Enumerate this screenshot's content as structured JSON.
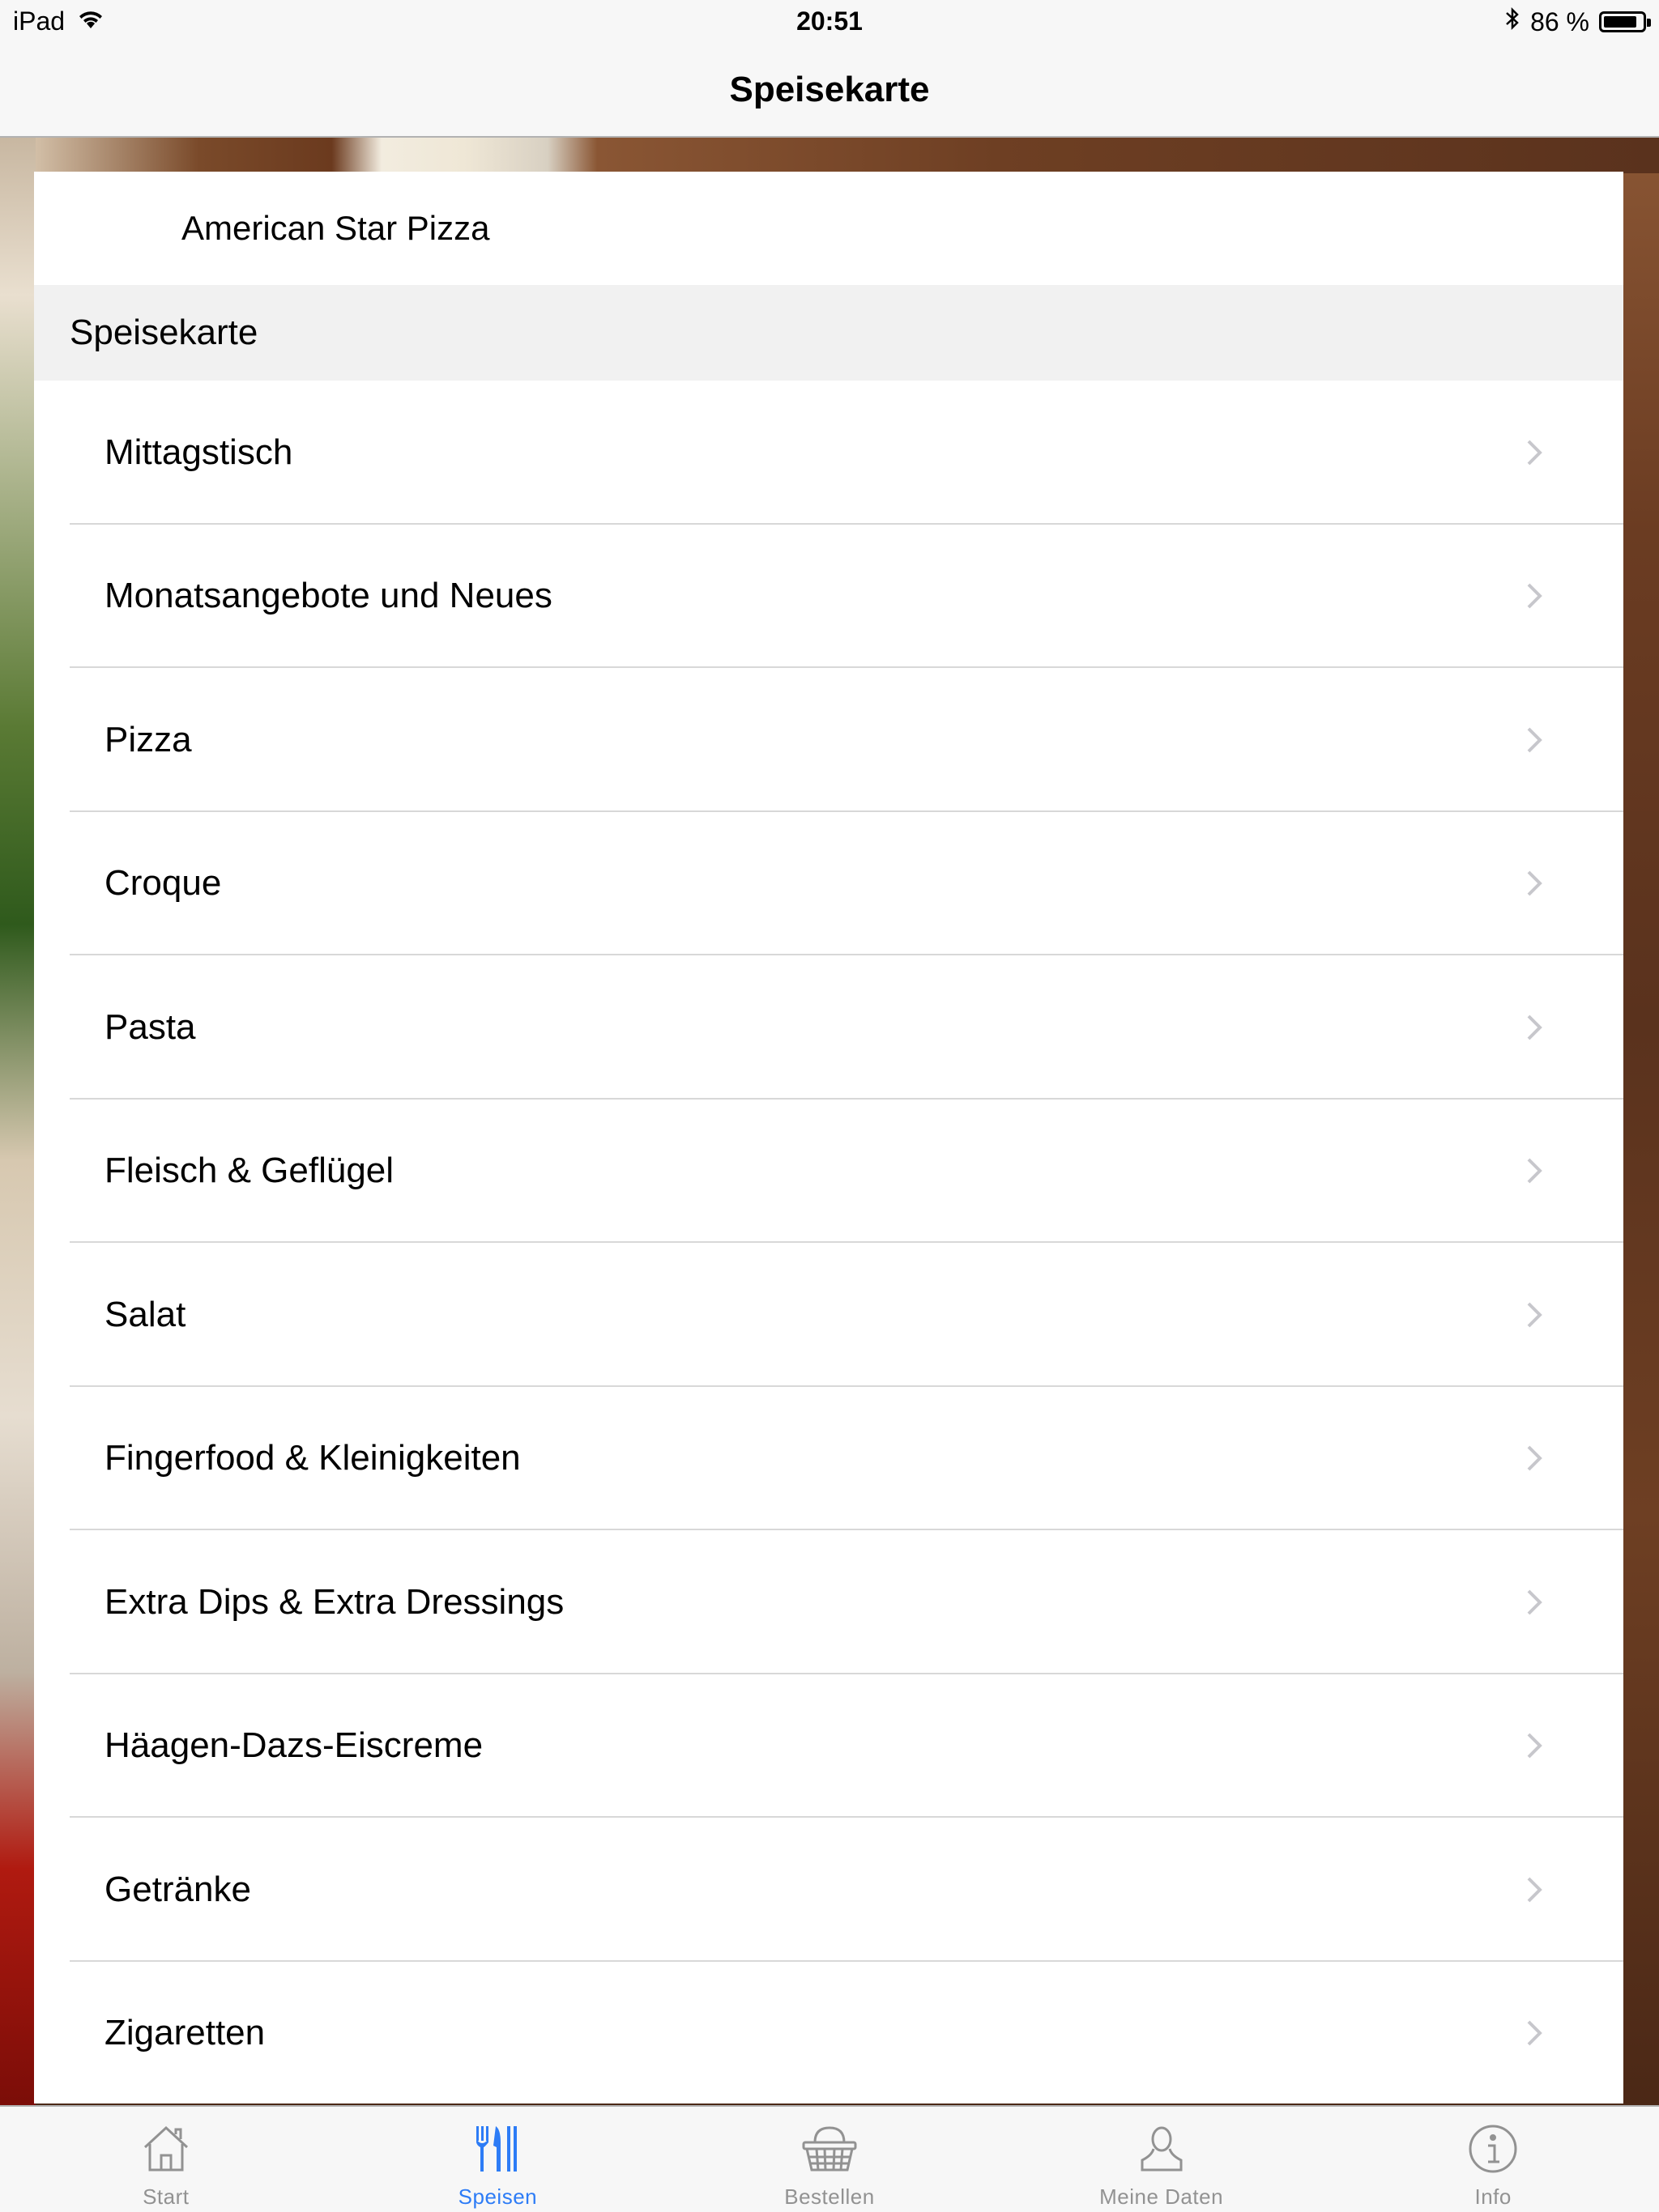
{
  "status_bar": {
    "device": "iPad",
    "time": "20:51",
    "battery_text": "86 %",
    "battery_level": 0.86
  },
  "navbar": {
    "title": "Speisekarte"
  },
  "restaurant_name": "American Star Pizza",
  "section_header": "Speisekarte",
  "menu_items": [
    {
      "label": "Mittagstisch"
    },
    {
      "label": "Monatsangebote und Neues"
    },
    {
      "label": "Pizza"
    },
    {
      "label": "Croque"
    },
    {
      "label": "Pasta"
    },
    {
      "label": "Fleisch & Geflügel"
    },
    {
      "label": "Salat"
    },
    {
      "label": "Fingerfood & Kleinigkeiten"
    },
    {
      "label": "Extra Dips & Extra Dressings"
    },
    {
      "label": "Häagen-Dazs-Eiscreme"
    },
    {
      "label": "Getränke"
    },
    {
      "label": "Zigaretten"
    }
  ],
  "tabs": [
    {
      "label": "Start",
      "icon": "home-icon",
      "active": false
    },
    {
      "label": "Speisen",
      "icon": "fork-knife-icon",
      "active": true
    },
    {
      "label": "Bestellen",
      "icon": "basket-icon",
      "active": false
    },
    {
      "label": "Meine Daten",
      "icon": "user-icon",
      "active": false
    },
    {
      "label": "Info",
      "icon": "info-icon",
      "active": false
    }
  ],
  "colors": {
    "accent": "#2d7cf6",
    "inactive_tab": "#929292",
    "bar_background": "#f7f7f7",
    "section_header_bg": "#f1f1f1"
  }
}
